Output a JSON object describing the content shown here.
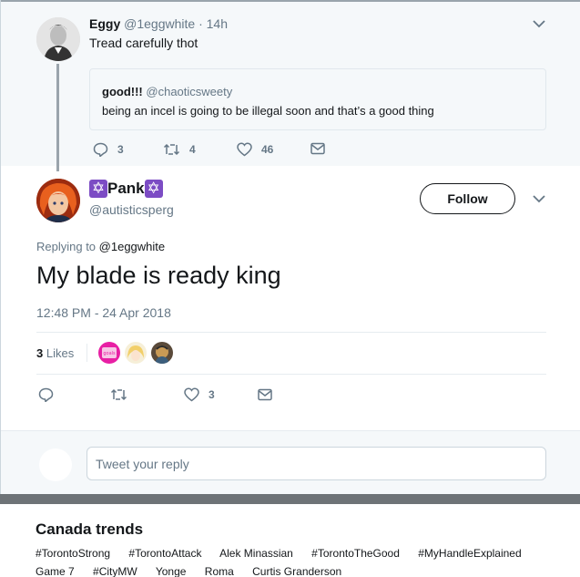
{
  "parent_tweet": {
    "name": "Eggy",
    "handle": "@1eggwhite",
    "dot": "·",
    "time": "14h",
    "text": "Tread carefully thot",
    "quote": {
      "name": "good!!!",
      "handle": "@chaoticsweety",
      "text": "being an incel is going to be illegal soon and that’s a good thing"
    },
    "actions": {
      "replies": "3",
      "retweets": "4",
      "likes": "46"
    }
  },
  "main_tweet": {
    "name": "Pank",
    "name_symbol": "✡",
    "handle": "@autisticsperg",
    "follow_label": "Follow",
    "replying_prefix": "Replying to",
    "replying_to": "@1eggwhite",
    "text": "My blade is ready king",
    "timestamp": "12:48 PM - 24 Apr 2018",
    "likes_count": "3",
    "likes_label": "Likes",
    "liker_avatar_text": "goals",
    "actions": {
      "replies": "",
      "retweets": "",
      "likes": "3"
    }
  },
  "reply": {
    "placeholder": "Tweet your reply"
  },
  "trends": {
    "title": "Canada trends",
    "row1": [
      "#TorontoStrong",
      "#TorontoAttack",
      "Alek Minassian",
      "#TorontoTheGood",
      "#MyHandleExplained"
    ],
    "row2": [
      "Game 7",
      "#CityMW",
      "Yonge",
      "Roma",
      "Curtis Granderson"
    ]
  },
  "colors": {
    "accent": "#1da1f2",
    "text": "#14171a",
    "muted": "#657786",
    "symbol": "#7c4cc4"
  }
}
